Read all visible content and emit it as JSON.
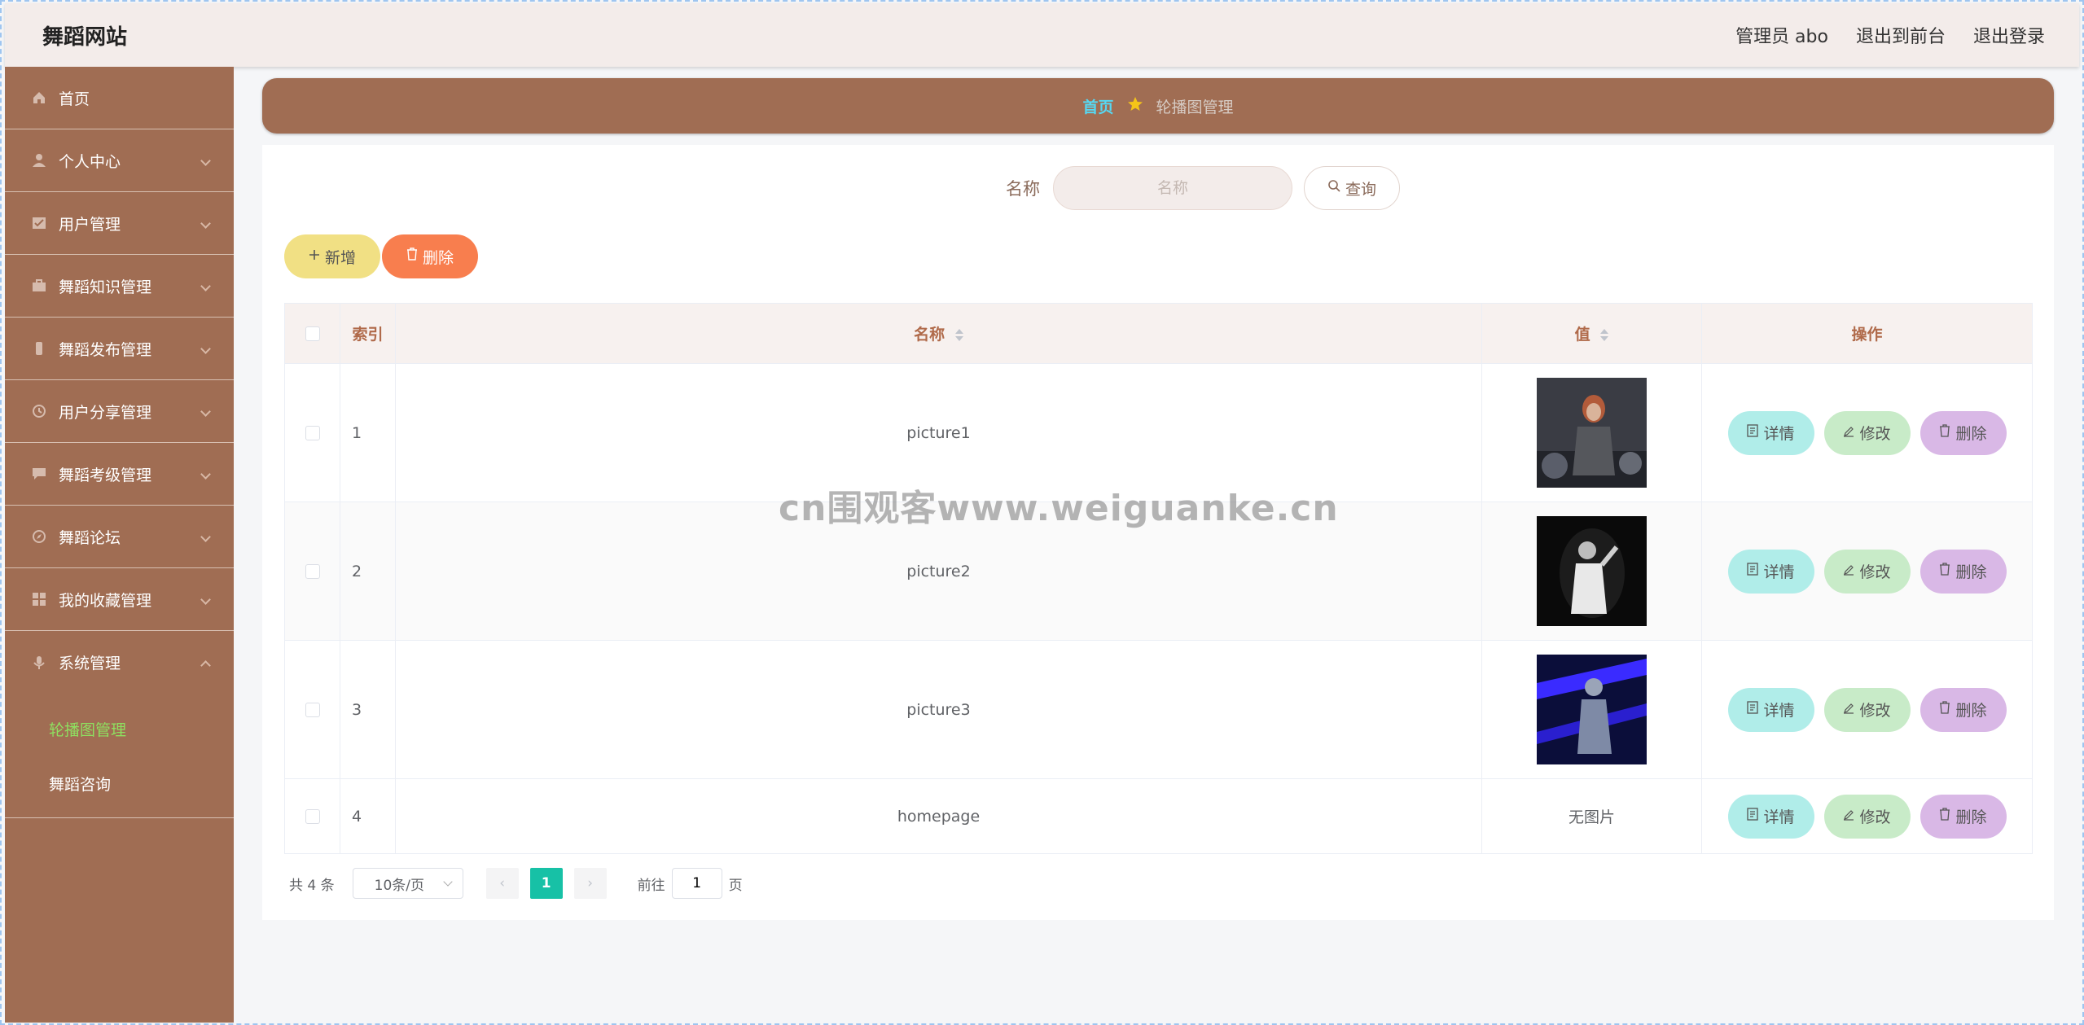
{
  "header": {
    "brand": "舞蹈网站",
    "admin_label": "管理员 abo",
    "exit_front": "退出到前台",
    "logout": "退出登录"
  },
  "sidebar": {
    "items": [
      {
        "label": "首页",
        "icon": "home-icon"
      },
      {
        "label": "个人中心",
        "icon": "user-icon"
      },
      {
        "label": "用户管理",
        "icon": "checklist-icon"
      },
      {
        "label": "舞蹈知识管理",
        "icon": "briefcase-icon"
      },
      {
        "label": "舞蹈发布管理",
        "icon": "mobile-icon"
      },
      {
        "label": "用户分享管理",
        "icon": "clock-icon"
      },
      {
        "label": "舞蹈考级管理",
        "icon": "chat-icon"
      },
      {
        "label": "舞蹈论坛",
        "icon": "compass-icon"
      },
      {
        "label": "我的收藏管理",
        "icon": "grid-icon"
      },
      {
        "label": "系统管理",
        "icon": "microphone-icon"
      }
    ],
    "sub_items": [
      {
        "label": "轮播图管理",
        "active": true
      },
      {
        "label": "舞蹈咨询",
        "active": false
      }
    ]
  },
  "breadcrumb": {
    "home": "首页",
    "current": "轮播图管理"
  },
  "search": {
    "label": "名称",
    "placeholder": "名称",
    "button": "查询"
  },
  "actions": {
    "add": "新增",
    "delete": "删除"
  },
  "table": {
    "columns": [
      "索引",
      "名称",
      "值",
      "操作"
    ],
    "rows": [
      {
        "index": "1",
        "name": "picture1",
        "value": "image",
        "image": "dancer-gray"
      },
      {
        "index": "2",
        "name": "picture2",
        "value": "image",
        "image": "dancer-black"
      },
      {
        "index": "3",
        "name": "picture3",
        "value": "image",
        "image": "dancer-blue"
      },
      {
        "index": "4",
        "name": "homepage",
        "value": "无图片",
        "image": null
      }
    ],
    "row_actions": {
      "detail": "详情",
      "edit": "修改",
      "remove": "删除"
    }
  },
  "pagination": {
    "total": "共 4 条",
    "page_size": "10条/页",
    "current_page": "1",
    "goto_prefix": "前往",
    "goto_value": "1",
    "goto_suffix": "页"
  },
  "watermark": "cn围观客www.weiguanke.cn",
  "colors": {
    "sidebar_bg": "#a06d53",
    "header_bg": "#f3ecea",
    "active_sub": "#8ee060",
    "crumb_home": "#56d8f2",
    "page_active": "#17c1a6"
  }
}
